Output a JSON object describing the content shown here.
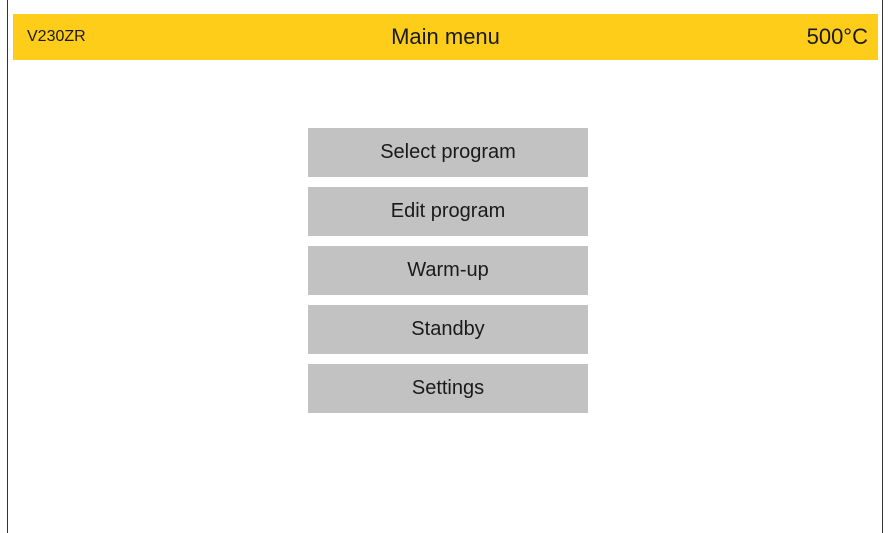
{
  "header": {
    "model": "V230ZR",
    "title": "Main menu",
    "temperature": "500°C"
  },
  "menu": {
    "items": [
      {
        "label": "Select program"
      },
      {
        "label": "Edit program"
      },
      {
        "label": "Warm-up"
      },
      {
        "label": "Standby"
      },
      {
        "label": "Settings"
      }
    ]
  },
  "colors": {
    "header_bg": "#fdcd1a",
    "button_bg": "#c2c2c2",
    "text": "#1a1a1a"
  }
}
